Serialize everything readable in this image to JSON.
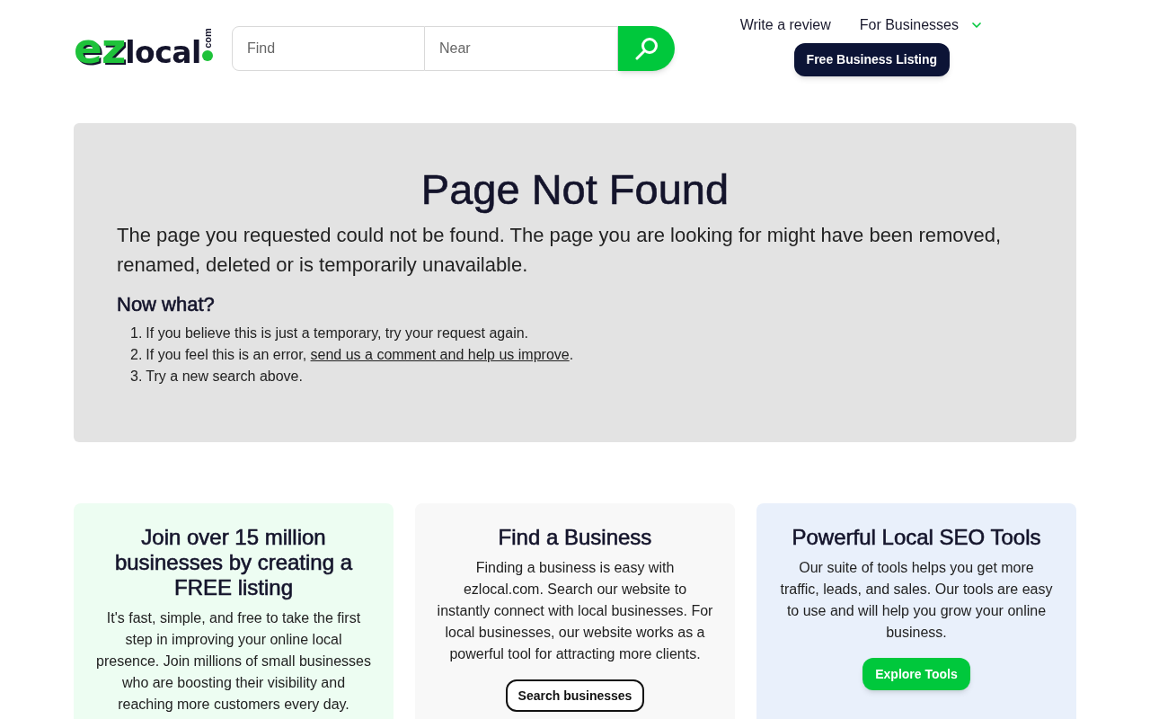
{
  "header": {
    "logo": {
      "part_1": "ez",
      "part_2": "local",
      "suffix": "com"
    },
    "search": {
      "find_placeholder": "Find",
      "near_placeholder": "Near"
    },
    "nav": [
      {
        "label": "Write a review",
        "kind": "link"
      },
      {
        "label": "For Businesses",
        "kind": "dropdown"
      }
    ],
    "cta": "Free Business Listing"
  },
  "error_panel": {
    "title": "Page Not Found",
    "message": "The page you requested could not be found. The page you are looking for might have been removed, renamed, deleted or is temporarily unavailable.",
    "subheading": "Now what?",
    "steps": [
      {
        "number": "1.",
        "text": "If you believe this is just a temporary, try your request again."
      },
      {
        "number": "2.",
        "text": "If you feel this is an error, ",
        "link": "send us a comment and help us improve",
        "after": "."
      },
      {
        "number": "3.",
        "text": "Try a new search above."
      }
    ]
  },
  "cards": [
    {
      "title": "Join over 15 million businesses by creating a FREE listing",
      "body": "It's fast, simple, and free to take the first step in improving your online local presence. Join millions of small businesses who are boosting their visibility and reaching more customers every day.",
      "color": "#edfdf2"
    },
    {
      "title": "Find a Business",
      "body": "Finding a business is easy with ezlocal.com. Search our website to instantly connect with local businesses. For local businesses, our website works as a powerful tool for attracting more clients.",
      "color": "#f8f8f8",
      "button": {
        "label": "Search businesses",
        "kind": "outline"
      }
    },
    {
      "title": "Powerful Local SEO Tools",
      "body": "Our suite of tools helps you get more traffic, leads, and sales. Our tools are easy to use and will help you grow your online business.",
      "color": "#e9f0fb",
      "button": {
        "label": "Explore Tools",
        "kind": "solid"
      }
    }
  ]
}
